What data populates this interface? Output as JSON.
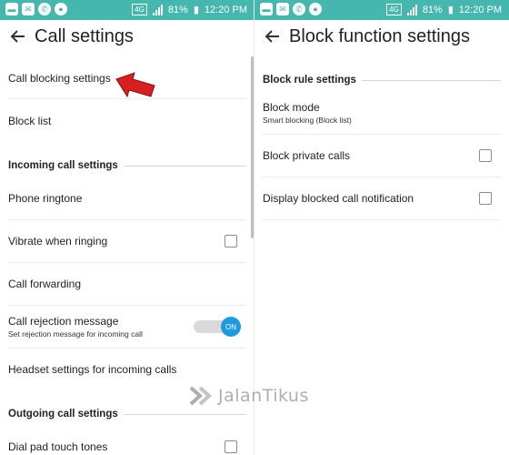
{
  "status_bar": {
    "network": "4G",
    "battery": "81%",
    "time": "12:20 PM",
    "icons": [
      "chat-icon",
      "mail-icon",
      "whatsapp-icon",
      "location-icon"
    ]
  },
  "left_screen": {
    "title": "Call settings",
    "call_blocking_settings": "Call blocking settings",
    "block_list": "Block list",
    "incoming_section": "Incoming call settings",
    "phone_ringtone": "Phone ringtone",
    "vibrate_when_ringing": "Vibrate when ringing",
    "vibrate_checked": false,
    "call_forwarding": "Call forwarding",
    "call_rejection_message": "Call rejection message",
    "call_rejection_sub": "Set rejection message for incoming call",
    "call_rejection_toggle": "ON",
    "headset_settings": "Headset settings for incoming calls",
    "outgoing_section": "Outgoing call settings",
    "dial_pad_touch_tones": "Dial pad touch tones",
    "dial_pad_checked": false
  },
  "right_screen": {
    "title": "Block function settings",
    "block_rule_section": "Block rule settings",
    "block_mode": "Block mode",
    "block_mode_value": "Smart blocking (Block list)",
    "block_private_calls": "Block private calls",
    "block_private_checked": false,
    "display_blocked_notification": "Display blocked call notification",
    "display_blocked_checked": false
  },
  "watermark": {
    "text": "JalanTikus"
  },
  "colors": {
    "status_bar": "#45b7ae",
    "toggle_on": "#1e9be0",
    "annotation_arrow": "#d42020"
  }
}
